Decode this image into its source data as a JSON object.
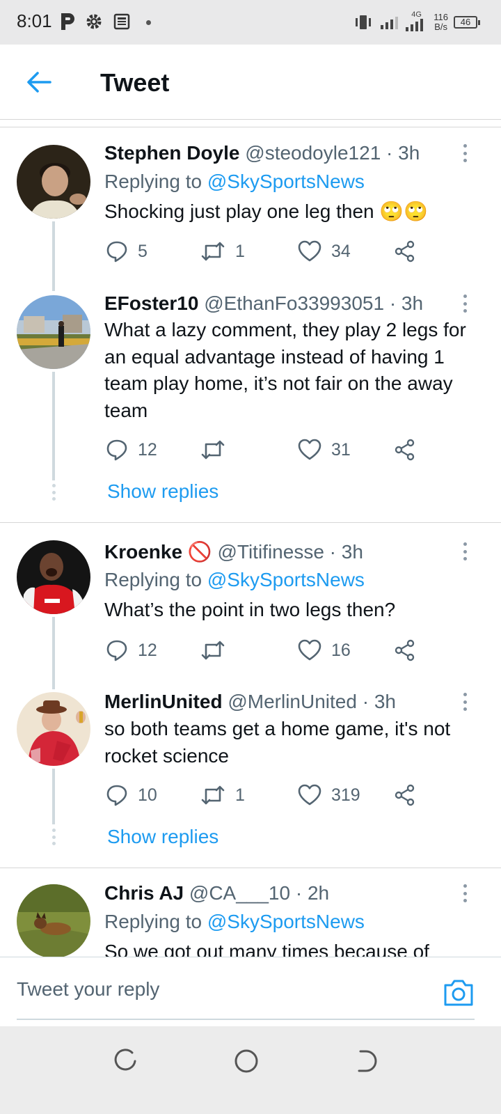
{
  "status_bar": {
    "time": "8:01",
    "network": "4G",
    "speed_value": "116",
    "speed_unit": "B/s",
    "battery": "46"
  },
  "header": {
    "title": "Tweet",
    "back_icon": "arrow-left-icon"
  },
  "tweets": [
    {
      "name": "Stephen Doyle",
      "handle": "@steodoyle121 · 3h",
      "reply_prefix": "Replying to ",
      "reply_to": "@SkySportsNews",
      "text": "Shocking just play one leg then 🙄🙄",
      "replies": "5",
      "retweets": "1",
      "likes": "34"
    },
    {
      "name": "EFoster10",
      "handle": "@EthanFo33993051 · 3h",
      "text": "What a lazy comment, they play 2 legs for an equal advantage instead of having 1 team play home, it’s not fair on the away team",
      "replies": "12",
      "retweets": "",
      "likes": "31",
      "show_replies": "Show replies"
    },
    {
      "name": "Kroenke 🚫",
      "handle": "@Titifinesse · 3h",
      "reply_prefix": "Replying to ",
      "reply_to": "@SkySportsNews",
      "text": "What’s the point in two legs then?",
      "replies": "12",
      "retweets": "",
      "likes": "16"
    },
    {
      "name": "MerlinUnited",
      "handle": "@MerlinUnited · 3h",
      "text": "so both teams get a home game, it's not rocket science",
      "replies": "10",
      "retweets": "1",
      "likes": "319",
      "show_replies": "Show replies"
    },
    {
      "name": "Chris AJ",
      "handle": "@CA___10 · 2h",
      "reply_prefix": "Replying to ",
      "reply_to": "@SkySportsNews",
      "text": "So we got out many times because of"
    }
  ],
  "reply_bar": {
    "placeholder": "Tweet your reply",
    "camera_icon": "camera-icon"
  },
  "colors": {
    "accent": "#1d9bf0",
    "secondary_text": "#536471",
    "divider": "#d6d6d6"
  }
}
